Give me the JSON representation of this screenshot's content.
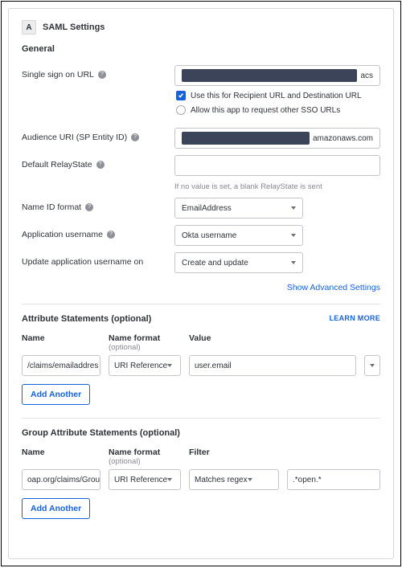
{
  "header": {
    "letter": "A",
    "title": "SAML Settings"
  },
  "general": {
    "title": "General",
    "sso_url": {
      "label": "Single sign on URL",
      "suffix": "acs",
      "use_recipient": {
        "checked": true,
        "label": "Use this for Recipient URL and Destination URL"
      },
      "allow_other": {
        "checked": false,
        "label": "Allow this app to request other SSO URLs"
      }
    },
    "audience_uri": {
      "label": "Audience URI (SP Entity ID)",
      "suffix": "amazonaws.com"
    },
    "relaystate": {
      "label": "Default RelayState",
      "helper": "If no value is set, a blank RelayState is sent"
    },
    "nameid": {
      "label": "Name ID format",
      "value": "EmailAddress"
    },
    "app_username": {
      "label": "Application username",
      "value": "Okta username"
    },
    "update_on": {
      "label": "Update application username on",
      "value": "Create and update"
    },
    "advanced_link": "Show Advanced Settings"
  },
  "attr": {
    "title": "Attribute Statements (optional)",
    "learn": "LEARN MORE",
    "cols": {
      "name": "Name",
      "fmt": "Name format",
      "fmt_sub": "(optional)",
      "val": "Value"
    },
    "row": {
      "name": "/claims/emailaddres",
      "fmt": "URI Reference",
      "val": "user.email"
    },
    "add": "Add Another"
  },
  "group_attr": {
    "title": "Group Attribute Statements (optional)",
    "cols": {
      "name": "Name",
      "fmt": "Name format",
      "fmt_sub": "(optional)",
      "filter": "Filter"
    },
    "row": {
      "name": "oap.org/claims/Grou",
      "fmt": "URI Reference",
      "filter": "Matches regex",
      "regex": ".*open.*"
    },
    "add": "Add Another"
  }
}
